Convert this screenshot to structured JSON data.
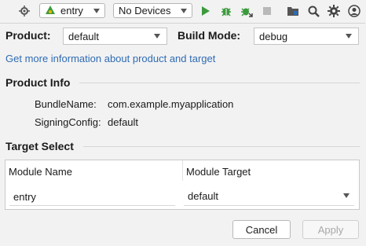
{
  "toolbar": {
    "module_selector": {
      "value": "entry",
      "icon": "android-app-icon"
    },
    "device_selector": {
      "value": "No Devices"
    },
    "icons": [
      "target-icon",
      "run-icon",
      "debug-icon",
      "attach-debugger-icon",
      "stop-icon",
      "project-structure-icon",
      "search-icon",
      "settings-icon",
      "account-icon"
    ],
    "colors": {
      "run": "#3c9a3c",
      "debug": "#3c9a3c",
      "stop": "#b9b9b9"
    }
  },
  "dialog": {
    "product_label": "Product:",
    "product_value": "default",
    "build_mode_label": "Build Mode:",
    "build_mode_value": "debug",
    "info_link": "Get more information about product and target",
    "product_info": {
      "title": "Product Info",
      "bundle_name_label": "BundleName:",
      "bundle_name_value": "com.example.myapplication",
      "signing_label": "SigningConfig:",
      "signing_value": "default"
    },
    "target_select": {
      "title": "Target Select",
      "columns": [
        "Module Name",
        "Module Target"
      ],
      "rows": [
        {
          "module": "entry",
          "target": "default"
        }
      ]
    },
    "buttons": {
      "cancel": "Cancel",
      "apply": "Apply"
    },
    "colors": {
      "link": "#2f6bb3"
    }
  }
}
